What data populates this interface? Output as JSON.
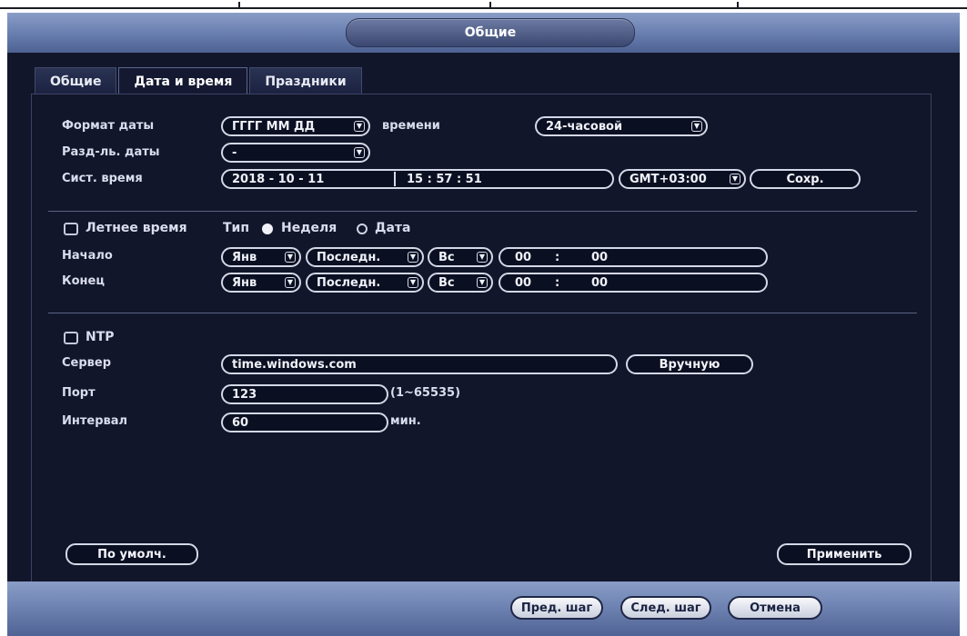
{
  "window": {
    "title": "Общие"
  },
  "tabs": [
    {
      "label": "Общие",
      "active": false
    },
    {
      "label": "Дата и время",
      "active": true
    },
    {
      "label": "Праздники",
      "active": false
    }
  ],
  "date_format": {
    "label": "Формат даты",
    "value": "ГГГГ ММ ДД"
  },
  "time_format": {
    "label": "времени",
    "value": "24-часовой"
  },
  "date_separator": {
    "label": "Разд-ль. даты",
    "value": "-"
  },
  "system_time": {
    "label": "Сист. время",
    "date": "2018  - 10 - 11",
    "time": "15 : 57 : 51",
    "timezone": "GMT+03:00",
    "save_label": "Сохр."
  },
  "dst": {
    "label": "Летнее время",
    "checked": false,
    "type_label": "Тип",
    "option_week": "Неделя",
    "option_date": "Дата",
    "start": {
      "label": "Начало",
      "month": "Янв",
      "week": "Последн.",
      "day": "Вс",
      "hour": "00",
      "colon": ":",
      "minute": "00"
    },
    "end": {
      "label": "Конец",
      "month": "Янв",
      "week": "Последн.",
      "day": "Вс",
      "hour": "00",
      "colon": ":",
      "minute": "00"
    }
  },
  "ntp": {
    "label": "NTP",
    "checked": false,
    "server_label": "Сервер",
    "server": "time.windows.com",
    "manual_label": "Вручную",
    "port_label": "Порт",
    "port": "123",
    "port_range": "(1~65535)",
    "interval_label": "Интервал",
    "interval": "60",
    "interval_unit": "мин."
  },
  "actions": {
    "default_label": "По умолч.",
    "apply_label": "Применить"
  },
  "footer": {
    "prev_label": "Пред. шаг",
    "next_label": "След. шаг",
    "cancel_label": "Отмена"
  },
  "icons": {
    "dropdown": "dropdown-arrow-icon",
    "checkbox": "checkbox-icon"
  },
  "colors": {
    "accent": "#6d83b3",
    "panel_bg": "#12162a",
    "text": "#e6e9f2"
  }
}
